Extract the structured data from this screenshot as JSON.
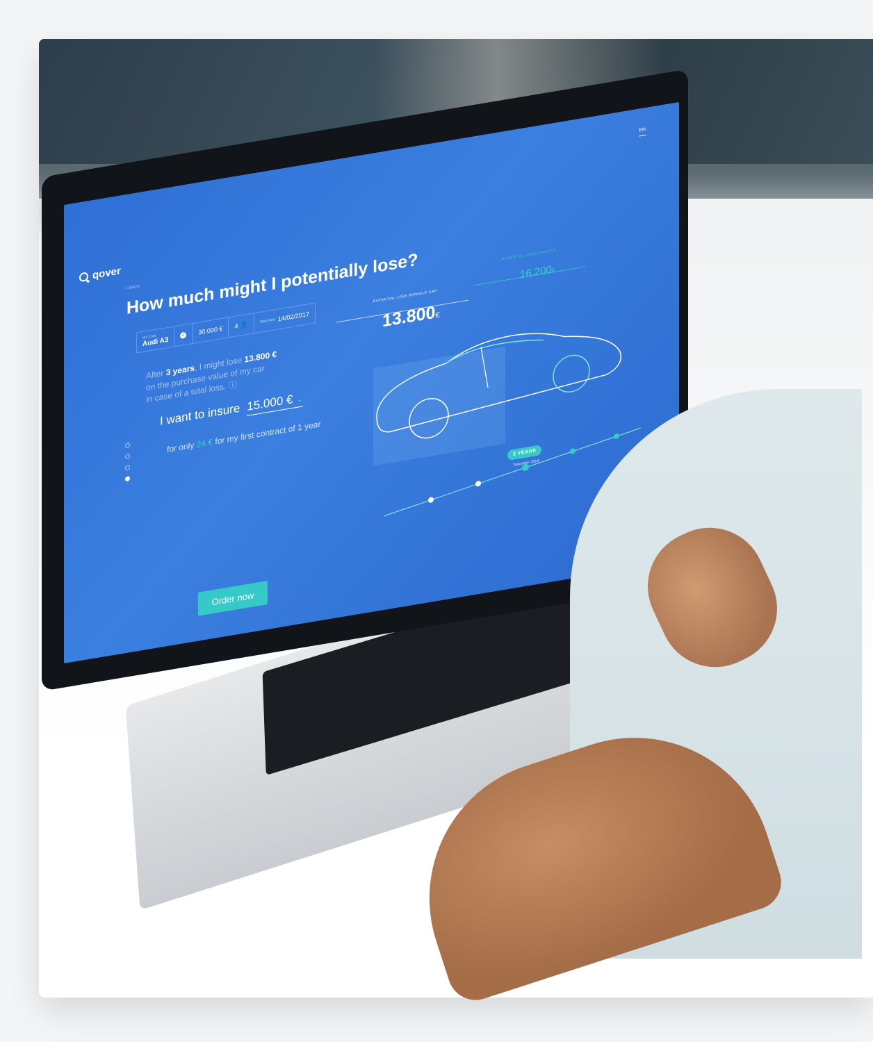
{
  "app": {
    "brand": "qover",
    "language": "EN",
    "back_label": "< BACK"
  },
  "page": {
    "title": "How much might I potentially lose?"
  },
  "car": {
    "caption": "MY CAR",
    "model": "Audi A3",
    "value": "30.000 €",
    "drivers": "4",
    "start_caption": "Start date:",
    "start_date": "14/02/2017"
  },
  "loss": {
    "line1_a": "After",
    "years": "3 years",
    "line1_b": ", I might lose",
    "amount": "13.800 €",
    "line2": "on the purchase value of my car",
    "line3": "in case of a total loss."
  },
  "insure": {
    "label": "I want to insure",
    "value": "15.000 €"
  },
  "price": {
    "prefix": "for only",
    "amount": "24 €",
    "suffix": "for my first contract of 1 year"
  },
  "order_button": "Order now",
  "chart": {
    "loss_label": "POTENTIAL LOSS WITHOUT GAP",
    "loss_value": "13.800",
    "loss_unit": "€",
    "gap_label": "POTENTIAL CASCO PAYOUT",
    "gap_value": "16.200",
    "gap_unit": "€",
    "selected": "3 YEARS",
    "total_label": "Total price: 208 €"
  },
  "colors": {
    "screen_blue": "#2f6fd6",
    "accent_teal": "#35c9c8"
  }
}
